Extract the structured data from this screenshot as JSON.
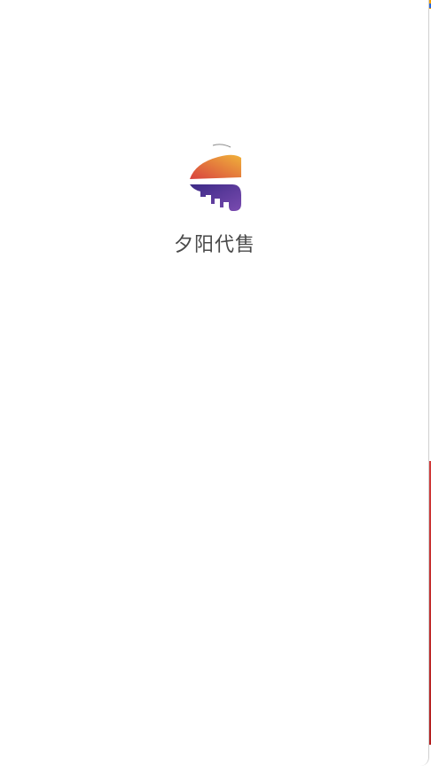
{
  "app": {
    "name": "夕阳代售",
    "logo_icon": "app-logo-icon"
  },
  "colors": {
    "background": "#ffffff",
    "text": "#4a4a4a",
    "logo_gradient_top": "#f0a53a",
    "logo_gradient_mid": "#e2533c",
    "logo_gradient_bottom": "#6a3fa0"
  }
}
